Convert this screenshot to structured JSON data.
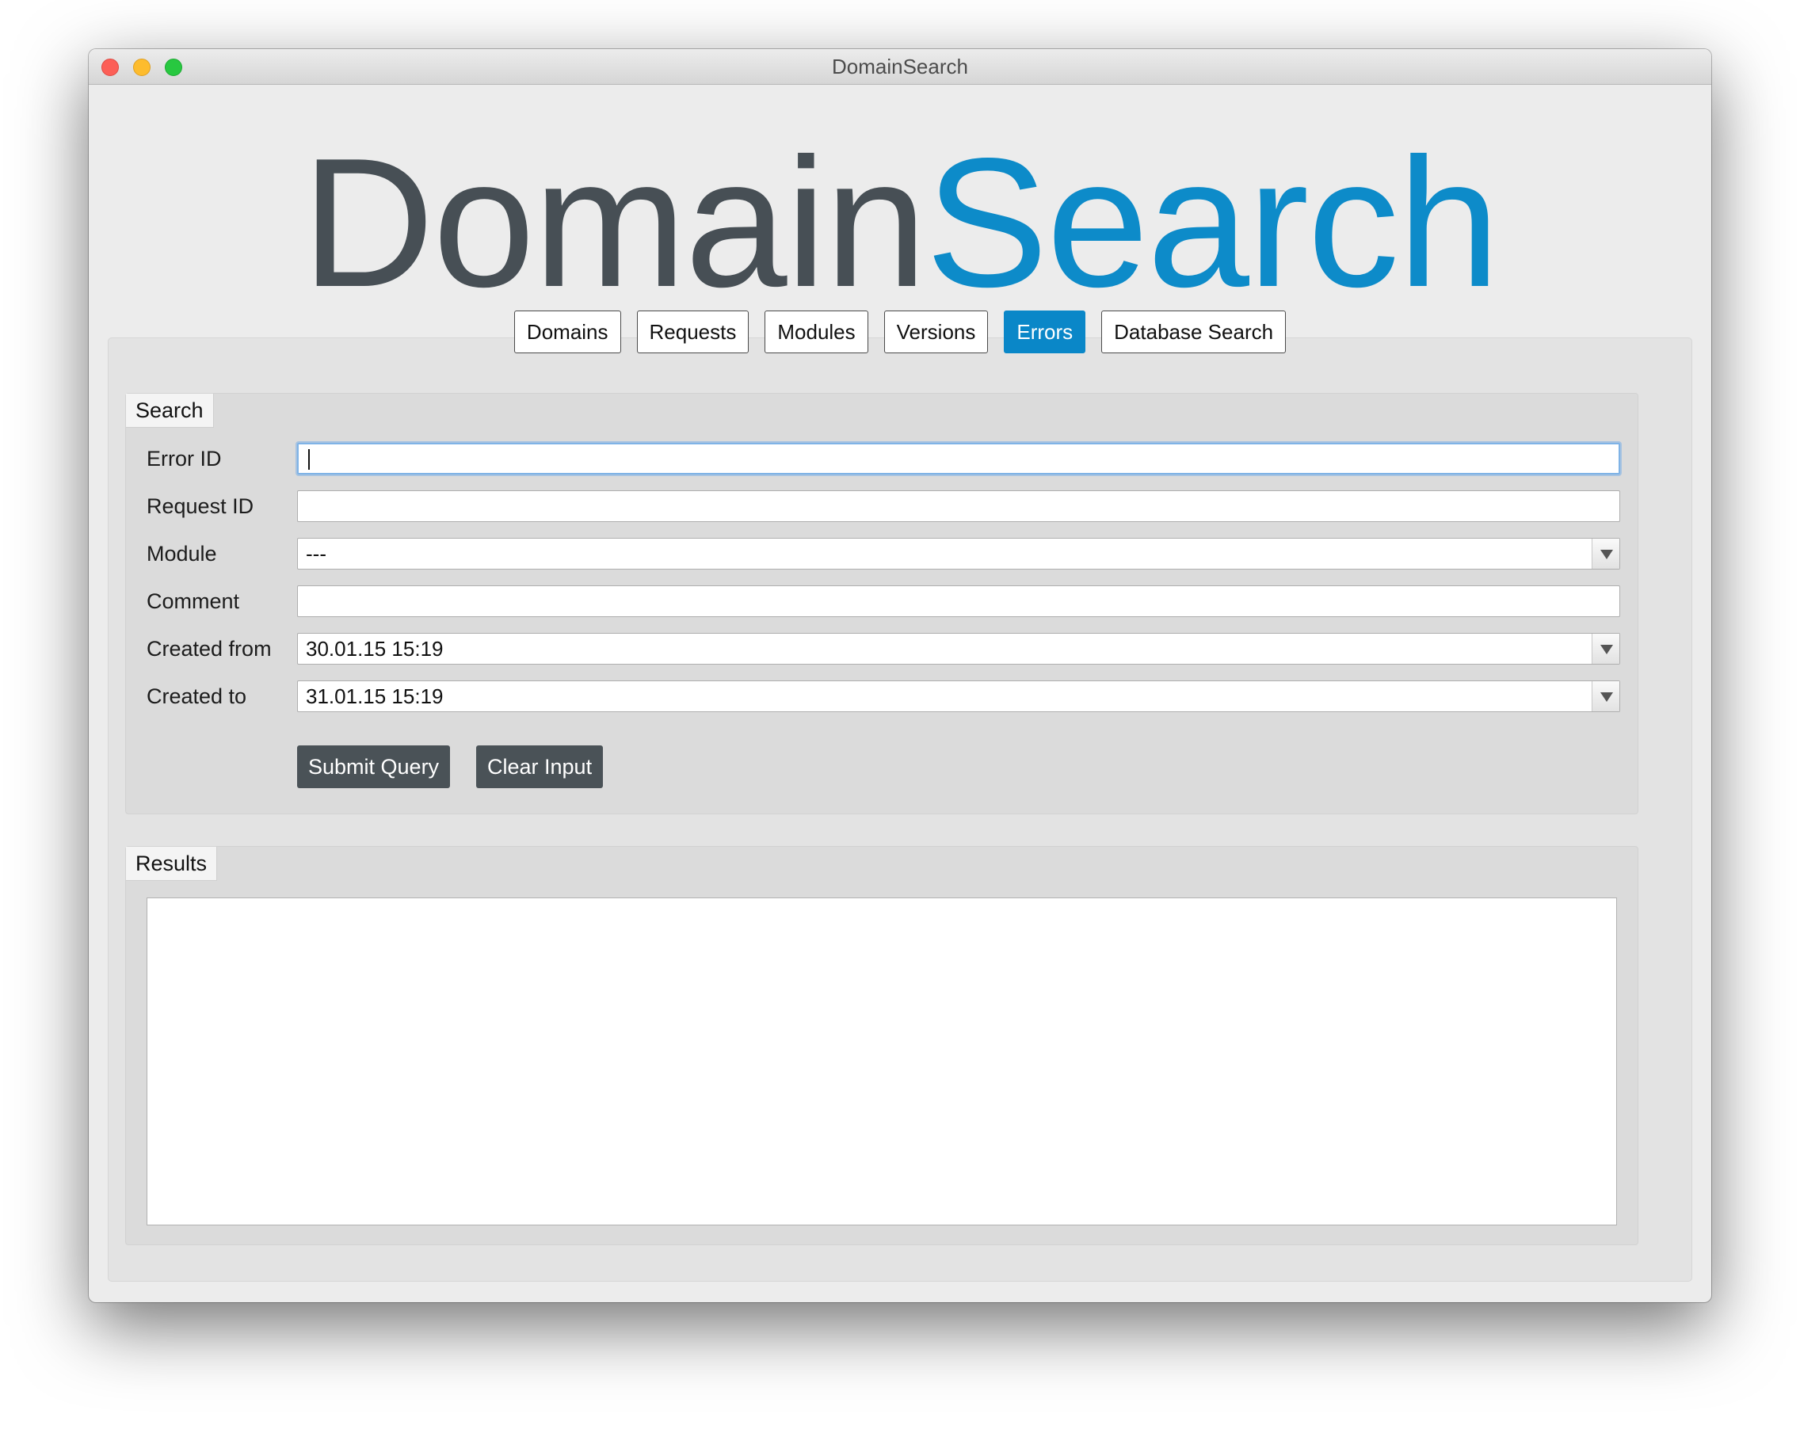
{
  "window": {
    "title": "DomainSearch"
  },
  "logo": {
    "part1": "Domain",
    "part2": "Search"
  },
  "tabs": [
    {
      "label": "Domains",
      "active": false
    },
    {
      "label": "Requests",
      "active": false
    },
    {
      "label": "Modules",
      "active": false
    },
    {
      "label": "Versions",
      "active": false
    },
    {
      "label": "Errors",
      "active": true
    },
    {
      "label": "Database Search",
      "active": false
    }
  ],
  "search": {
    "title": "Search",
    "fields": {
      "error_id": {
        "label": "Error ID",
        "value": ""
      },
      "request_id": {
        "label": "Request ID",
        "value": ""
      },
      "module": {
        "label": "Module",
        "value": "---"
      },
      "comment": {
        "label": "Comment",
        "value": ""
      },
      "created_from": {
        "label": "Created from",
        "value": "30.01.15 15:19"
      },
      "created_to": {
        "label": "Created to",
        "value": "31.01.15 15:19"
      }
    },
    "submit_label": "Submit Query",
    "clear_label": "Clear Input"
  },
  "results": {
    "title": "Results"
  },
  "colors": {
    "accent": "#0a87c8",
    "logo_dark": "#474f55",
    "button_dark": "#4a5257"
  }
}
